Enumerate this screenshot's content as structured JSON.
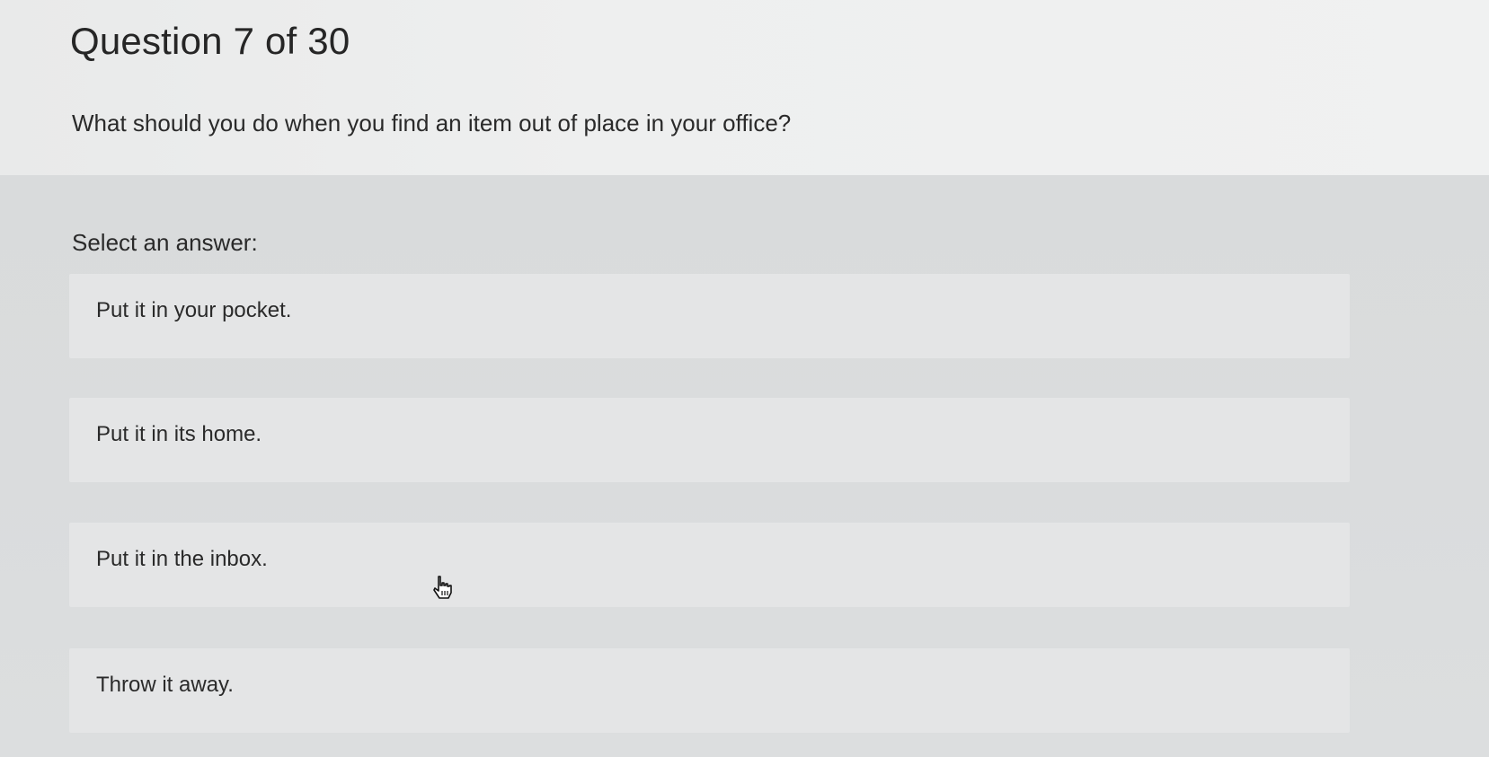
{
  "question": {
    "counter": "Question 7 of 30",
    "text": "What should you do when you find an item out of place in your office?"
  },
  "answers": {
    "prompt": "Select an answer:",
    "options": [
      {
        "label": "Put it in your pocket."
      },
      {
        "label": "Put it in its home."
      },
      {
        "label": "Put it in the inbox."
      },
      {
        "label": "Throw it away."
      }
    ]
  },
  "cursor": {
    "icon": "hand-pointer-icon"
  }
}
